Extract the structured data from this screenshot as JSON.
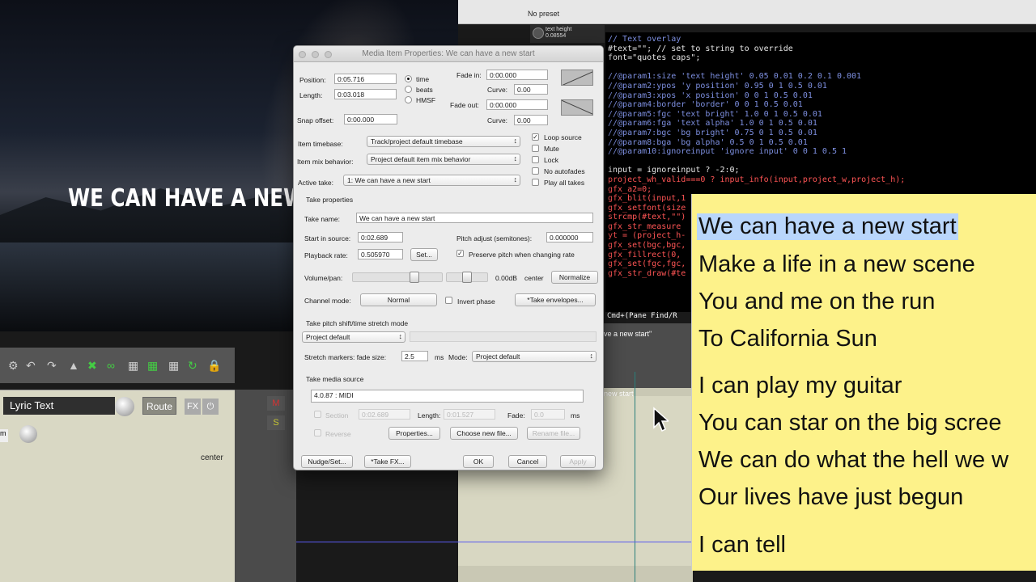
{
  "video": {
    "overlay_text": "WE CAN HAVE A NEW S"
  },
  "preset": {
    "label": "No preset"
  },
  "param_knob": {
    "label": "text height",
    "value": "0.08554"
  },
  "code": {
    "lines": [
      {
        "t": "// Text overlay",
        "c": "comment"
      },
      {
        "t": "#text=\"\"; // set to string to override",
        "c": "code"
      },
      {
        "t": "font=\"quotes caps\";",
        "c": "code"
      },
      {
        "t": "",
        "c": "code"
      },
      {
        "t": "//@param1:size 'text height' 0.05 0.01 0.2 0.1 0.001",
        "c": "comment"
      },
      {
        "t": "//@param2:ypos 'y position' 0.95 0 1 0.5 0.01",
        "c": "comment"
      },
      {
        "t": "//@param3:xpos 'x position' 0 0 1 0.5 0.01",
        "c": "comment"
      },
      {
        "t": "//@param4:border 'border' 0 0 1 0.5 0.01",
        "c": "comment"
      },
      {
        "t": "//@param5:fgc 'text bright' 1.0 0 1 0.5 0.01",
        "c": "comment"
      },
      {
        "t": "//@param6:fga 'text alpha' 1.0 0 1 0.5 0.01",
        "c": "comment"
      },
      {
        "t": "//@param7:bgc 'bg bright' 0.75 0 1 0.5 0.01",
        "c": "comment"
      },
      {
        "t": "//@param8:bga 'bg alpha' 0.5 0 1 0.5 0.01",
        "c": "comment"
      },
      {
        "t": "//@param10:ignoreinput 'ignore input' 0 0 1 0.5 1",
        "c": "comment"
      },
      {
        "t": "",
        "c": "code"
      },
      {
        "t": "input = ignoreinput ? -2:0;",
        "c": "code"
      },
      {
        "t": "project_wh_valid===0 ? input_info(input,project_w,project_h);",
        "c": "kw"
      },
      {
        "t": "gfx_a2=0;",
        "c": "kw"
      },
      {
        "t": "gfx_blit(input,1",
        "c": "kw"
      },
      {
        "t": "gfx_setfont(size",
        "c": "kw"
      },
      {
        "t": "strcmp(#text,\"\")",
        "c": "kw"
      },
      {
        "t": "gfx_str_measure",
        "c": "kw"
      },
      {
        "t": "yt = (project_h-",
        "c": "kw"
      },
      {
        "t": "gfx_set(bgc,bgc,",
        "c": "kw"
      },
      {
        "t": "gfx_fillrect(0,",
        "c": "kw"
      },
      {
        "t": "gfx_set(fgc,fgc,",
        "c": "kw"
      },
      {
        "t": "gfx_str_draw(#te",
        "c": "kw"
      }
    ],
    "status": "Cmd+(Pane Find/R"
  },
  "lyrics": [
    "We can have a new start",
    "Make a life in a new scene",
    "You and me on the run",
    "To California Sun",
    "I can play my guitar",
    "You can star on the big scree",
    "We can do what the hell we w",
    "Our lives have just begun",
    "I can tell"
  ],
  "timeline": {
    "item_label": "ve a new start\"",
    "item_start": "new start"
  },
  "track": {
    "name": "Lyric Text",
    "route": "Route",
    "fx": "FX",
    "power": "⏻",
    "m": "M",
    "s": "S",
    "pan": "center",
    "mini": "m"
  },
  "dialog": {
    "title": "Media Item Properties:  We can have a new start",
    "position_label": "Position:",
    "position_value": "0:05.716",
    "length_label": "Length:",
    "length_value": "0:03.018",
    "snap_label": "Snap offset:",
    "snap_value": "0:00.000",
    "timebase_radios": [
      "time",
      "beats",
      "HMSF"
    ],
    "fade_in_label": "Fade in:",
    "fade_in_value": "0:00.000",
    "curve_label": "Curve:",
    "curve_in_value": "0.00",
    "fade_out_label": "Fade out:",
    "fade_out_value": "0:00.000",
    "curve_out_value": "0.00",
    "item_timebase_label": "Item timebase:",
    "item_timebase_value": "Track/project default timebase",
    "item_mix_label": "Item mix behavior:",
    "item_mix_value": "Project default item mix behavior",
    "active_take_label": "Active take:",
    "active_take_value": "1: We can have a new start",
    "checks": [
      "Loop source",
      "Mute",
      "Lock",
      "No autofades",
      "Play all takes"
    ],
    "take_props_header": "Take properties",
    "take_name_label": "Take name:",
    "take_name_value": "We can have a new start",
    "start_label": "Start in source:",
    "start_value": "0:02.689",
    "pitch_label": "Pitch adjust (semitones):",
    "pitch_value": "0.000000",
    "rate_label": "Playback rate:",
    "rate_value": "0.505970",
    "set_label": "Set...",
    "preserve_label": "Preserve pitch when changing rate",
    "vol_label": "Volume/pan:",
    "vol_value": "0.00dB",
    "pan_value": "center",
    "normalize_label": "Normalize",
    "channel_label": "Channel mode:",
    "channel_value": "Normal",
    "invert_label": "Invert phase",
    "envelopes_label": "*Take envelopes...",
    "pitch_shift_header": "Take pitch shift/time stretch mode",
    "pitch_shift_value": "Project default",
    "stretch_label": "Stretch markers: fade size:",
    "stretch_value": "2.5",
    "ms_label": "ms",
    "mode_label": "Mode:",
    "mode_value": "Project default",
    "source_header": "Take media source",
    "source_value": "4.0.87 : MIDI",
    "section_label": "Section",
    "section_value": "0:02.689",
    "src_length_label": "Length:",
    "src_length_value": "0:01.527",
    "fade_label": "Fade:",
    "fade_value": "0.0",
    "fade_ms": "ms",
    "reverse_label": "Reverse",
    "properties_btn": "Properties...",
    "choose_btn": "Choose new file...",
    "rename_btn": "Rename file...",
    "nudge_btn": "Nudge/Set...",
    "takefx_btn": "*Take FX...",
    "ok_btn": "OK",
    "cancel_btn": "Cancel",
    "apply_btn": "Apply"
  }
}
